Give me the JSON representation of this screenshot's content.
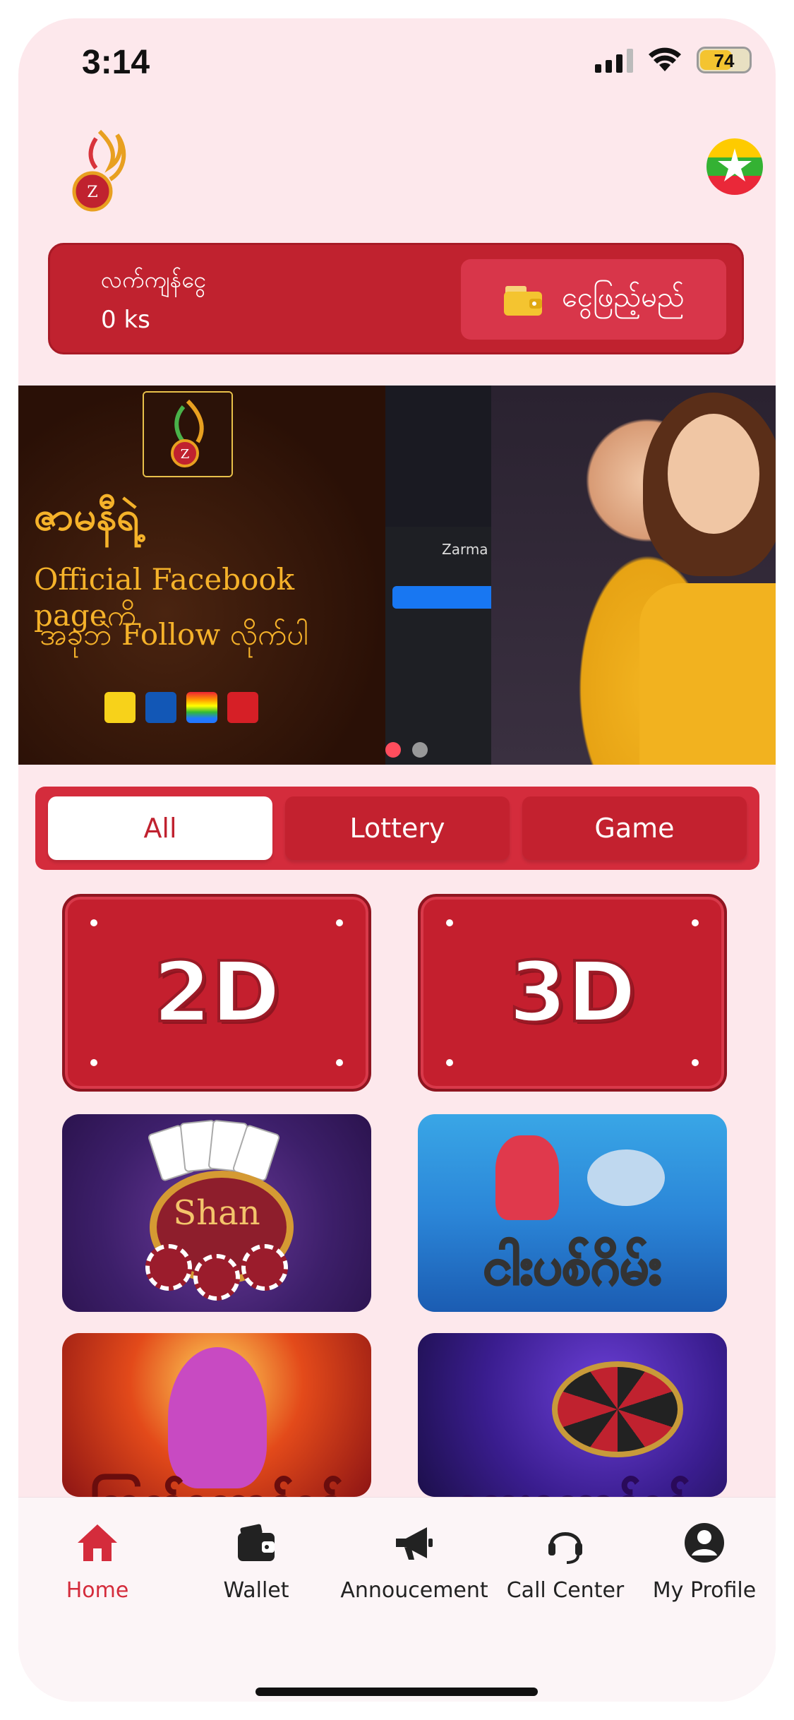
{
  "status_bar": {
    "time": "3:14",
    "battery": "74"
  },
  "balance": {
    "label": "လက်ကျန်ငွေ",
    "value": "0 ks",
    "deposit_label": "ငွေဖြည့်မည်"
  },
  "banner": {
    "heading": "ဇာမနီရဲ့",
    "line2": "Official Facebook pageကို",
    "line3": "အခုဘဲ Follow လိုက်ပါ",
    "fb_name": "Zarma",
    "pay_brands": [
      "wave-icon",
      "kbzpay-icon",
      "rainbow-icon",
      "ayapay-icon"
    ],
    "slides": 2,
    "active_slide": 1
  },
  "tabs": [
    {
      "label": "All",
      "active": true
    },
    {
      "label": "Lottery",
      "active": false
    },
    {
      "label": "Game",
      "active": false
    }
  ],
  "games": {
    "tile_2d": "2D",
    "tile_3d": "3D",
    "shan": "Shan",
    "fish": "ငါးပစ်ဂိမ်း",
    "lady": "ကြက်ကောင်ရင်",
    "roulette": "လေးကောင်ရင်"
  },
  "bottom_nav": [
    {
      "label": "Home",
      "icon": "home-icon",
      "active": true
    },
    {
      "label": "Wallet",
      "icon": "wallet-icon",
      "active": false
    },
    {
      "label": "Annoucement",
      "icon": "megaphone-icon",
      "active": false
    },
    {
      "label": "Call Center",
      "icon": "headset-icon",
      "active": false
    },
    {
      "label": "My Profile",
      "icon": "profile-icon",
      "active": false
    }
  ],
  "colors": {
    "primary": "#c0222f",
    "background": "#fde8ec",
    "accent_gold": "#f5b22a"
  }
}
